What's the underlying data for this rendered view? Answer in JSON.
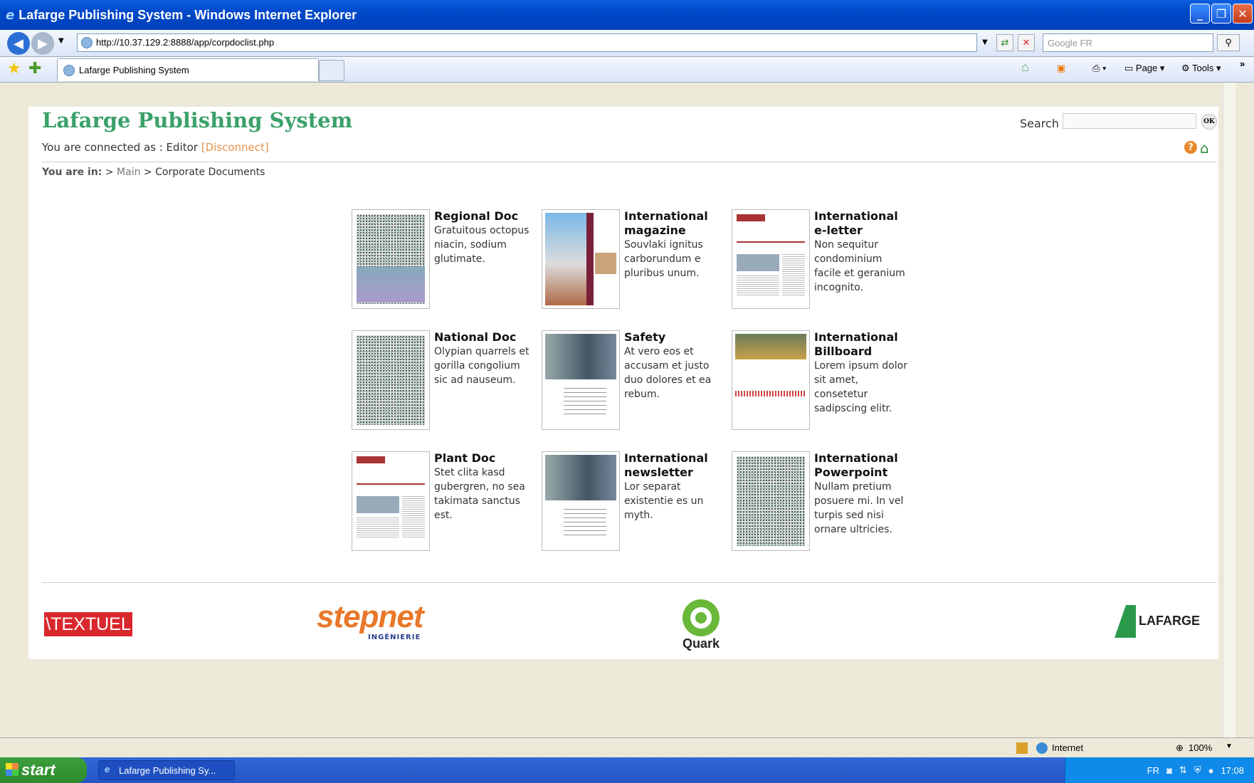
{
  "window": {
    "title": "Lafarge Publishing System - Windows Internet Explorer"
  },
  "browser": {
    "url": "http://10.37.129.2:8888/app/corpdoclist.php",
    "search_placeholder": "Google FR",
    "tab_title": "Lafarge Publishing System",
    "page_label": "Page",
    "tools_label": "Tools"
  },
  "app": {
    "title": "Lafarge Publishing System",
    "connected_text": "You are connected as : Editor",
    "disconnect_label": "[Disconnect]",
    "search_label": "Search",
    "ok_label": "OK",
    "breadcrumb": {
      "prefix": "You are in:",
      "sep1": ">",
      "main": "Main",
      "sep2": ">",
      "current": "Corporate Documents"
    }
  },
  "documents": [
    {
      "title": "Regional Doc",
      "desc": "Gratuitous octopus niacin, sodium glutimate."
    },
    {
      "title": "International magazine",
      "desc": "Souvlaki ignitus carborundum e pluribus unum."
    },
    {
      "title": "International e-letter",
      "desc": "Non sequitur condominium facile et geranium incognito."
    },
    {
      "title": "National Doc",
      "desc": "Olypian quarrels et gorilla congolium sic ad nauseum."
    },
    {
      "title": "Safety",
      "desc": "At vero eos et accusam et justo duo dolores et ea rebum."
    },
    {
      "title": "International Billboard",
      "desc": "Lorem ipsum dolor sit amet, consetetur sadipscing elitr."
    },
    {
      "title": "Plant Doc",
      "desc": "Stet clita kasd gubergren, no sea takimata sanctus est."
    },
    {
      "title": "International newsletter",
      "desc": "Lor separat existentie es un myth."
    },
    {
      "title": "International Powerpoint",
      "desc": "Nullam pretium posuere mi. In vel turpis sed nisi ornare ultricies."
    }
  ],
  "footer_logos": {
    "textuel": "\\TEXTUEL",
    "stepnet": "stepnet",
    "stepnet_sub": "INGÉNIERIE",
    "quark": "Quark",
    "lafarge": "LAFARGE"
  },
  "status": {
    "zone": "Internet",
    "zoom": "100%"
  },
  "taskbar": {
    "start": "start",
    "item": "Lafarge Publishing Sy...",
    "lang": "FR",
    "clock": "17:08"
  },
  "colors": {
    "brand_green": "#3ba16a",
    "disconnect_orange": "#e8924a",
    "xp_blue": "#0049c9"
  }
}
